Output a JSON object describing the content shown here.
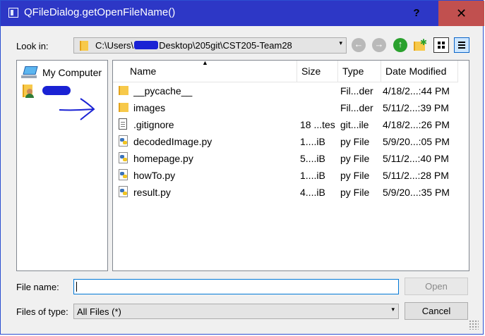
{
  "window": {
    "title": "QFileDialog.getOpenFileName()",
    "help_label": "?",
    "close_label": "✕"
  },
  "lookin": {
    "label": "Look in:",
    "path_prefix": "C:\\Users\\",
    "path_suffix": "Desktop\\205git\\CST205-Team28",
    "arrow": "▾"
  },
  "toolbar": {
    "back_icon": "←",
    "forward_icon": "→",
    "up_icon": "↑"
  },
  "sidebar": {
    "items": [
      {
        "label": "My Computer",
        "icon": "computer-icon"
      },
      {
        "label": "",
        "icon": "user-folder-icon"
      }
    ]
  },
  "filelist": {
    "columns": [
      "Name",
      "Size",
      "Type",
      "Date Modified"
    ],
    "sort_indicator": "▲",
    "rows": [
      {
        "name": "__pycache__",
        "size": "",
        "type": "Fil...der",
        "date": "4/18/2...:44 PM",
        "icon": "folder"
      },
      {
        "name": "images",
        "size": "",
        "type": "Fil...der",
        "date": "5/11/2...:39 PM",
        "icon": "folder"
      },
      {
        "name": ".gitignore",
        "size": "18 ...tes",
        "type": "git...ile",
        "date": "4/18/2...:26 PM",
        "icon": "doc"
      },
      {
        "name": "decodedImage.py",
        "size": "1....iB",
        "type": "py File",
        "date": "5/9/20...:05 PM",
        "icon": "py"
      },
      {
        "name": "homepage.py",
        "size": "5....iB",
        "type": "py File",
        "date": "5/11/2...:40 PM",
        "icon": "py"
      },
      {
        "name": "howTo.py",
        "size": "1....iB",
        "type": "py File",
        "date": "5/11/2...:28 PM",
        "icon": "py"
      },
      {
        "name": "result.py",
        "size": "4....iB",
        "type": "py File",
        "date": "5/9/20...:35 PM",
        "icon": "py"
      }
    ]
  },
  "bottom": {
    "filename_label": "File name:",
    "filename_value": "",
    "open_label": "Open",
    "filetype_label": "Files of type:",
    "filetype_value": "All Files (*)",
    "cancel_label": "Cancel",
    "arrow": "▾"
  },
  "colors": {
    "titlebar": "#2d37c6",
    "close_hover": "#c1504f",
    "redaction": "#1a22d4"
  }
}
